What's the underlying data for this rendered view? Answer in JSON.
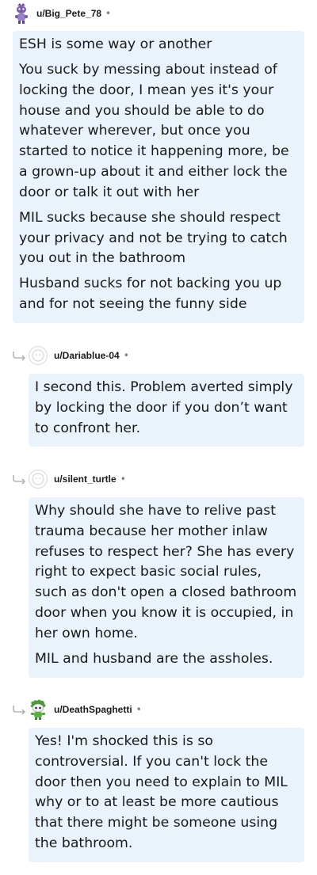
{
  "comments": [
    {
      "username": "u/Big_Pete_78",
      "separator": "•",
      "avatar_icon": "snoo-avatar-purple",
      "paragraphs": [
        "ESH is some way or another",
        "You suck by messing about instead of locking the door, I mean yes it's your house and you should be able to do whatever wherever, but once you started to notice it happening more, be a grown-up about it and either lock the door or talk it out with her",
        "MIL sucks because she should respect your privacy and not be trying to catch you out in the bathroom",
        "Husband sucks for not backing you up and for not seeing the funny side"
      ]
    },
    {
      "username": "u/Dariablue-04",
      "separator": "•",
      "avatar_icon": "default-avatar",
      "paragraphs": [
        "I second this. Problem averted simply by locking the door if you don’t want to confront her."
      ]
    },
    {
      "username": "u/silent_turtle",
      "separator": "•",
      "avatar_icon": "default-avatar",
      "paragraphs": [
        "Why should she have to relive past trauma because her mother inlaw refuses to respect her? She has every right to expect basic social rules, such as don't open a closed bathroom door when you know it is occupied, in her own home.",
        "MIL and husband are the assholes."
      ]
    },
    {
      "username": "u/DeathSpaghetti",
      "separator": "•",
      "avatar_icon": "snoo-avatar-green",
      "paragraphs": [
        "Yes! I'm shocked this is so controversial. If you can't lock the door then you need to explain to MIL why or to at least be more cautious that there might be someone using the bathroom."
      ]
    }
  ]
}
